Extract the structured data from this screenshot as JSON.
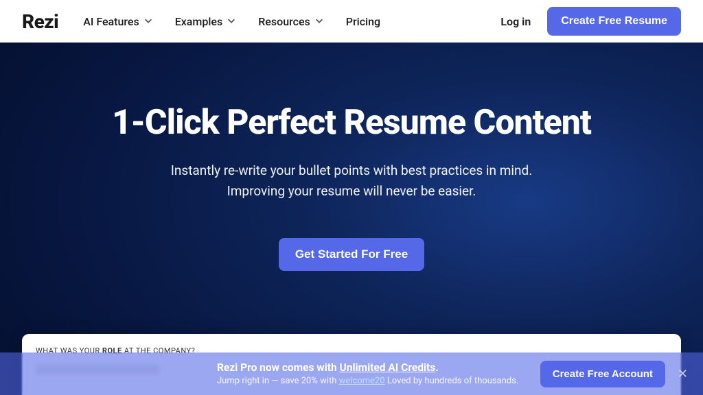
{
  "header": {
    "logo": "Rezi",
    "nav": [
      {
        "label": "AI Features",
        "has_dropdown": true
      },
      {
        "label": "Examples",
        "has_dropdown": true
      },
      {
        "label": "Resources",
        "has_dropdown": true
      },
      {
        "label": "Pricing",
        "has_dropdown": false
      }
    ],
    "login_label": "Log in",
    "cta_label": "Create Free Resume"
  },
  "hero": {
    "title": "1-Click Perfect Resume Content",
    "subtitle_line1": "Instantly re-write your bullet points with best practices in mind.",
    "subtitle_line2": "Improving your resume will never be easier.",
    "cta_label": "Get Started For Free"
  },
  "card": {
    "label_prefix": "WHAT WAS YOUR ",
    "label_bold": "ROLE",
    "label_suffix": " AT THE COMPANY?"
  },
  "banner": {
    "title_prefix": "Rezi Pro now comes with ",
    "title_underlined": "Unlimited AI Credits",
    "title_suffix": ".",
    "sub_prefix": "Jump right in — save 20% with ",
    "sub_code": "welcome20",
    "sub_suffix": "  Loved by hundreds of thousands.",
    "cta_label": "Create Free Account"
  },
  "colors": {
    "primary": "#5568e8",
    "hero_bg_dark": "#051031",
    "hero_bg_light": "#183a85"
  }
}
